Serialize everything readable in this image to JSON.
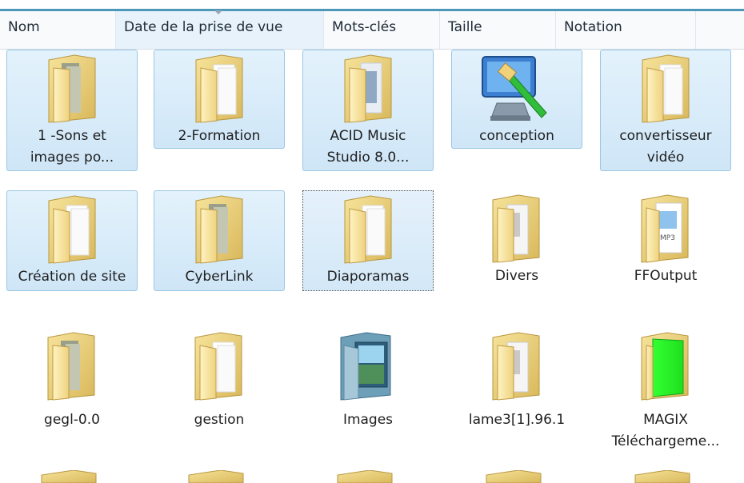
{
  "columns": [
    "Nom",
    "Date de la prise de vue",
    "Mots-clés",
    "Taille",
    "Notation"
  ],
  "items": [
    {
      "l1": "1 -Sons et",
      "l2": "images po...",
      "icon": "folder-files-icon"
    },
    {
      "l1": "2-Formation",
      "l2": "",
      "icon": "folder-icon"
    },
    {
      "l1": "ACID Music",
      "l2": "Studio 8.0...",
      "icon": "folder-files-icon"
    },
    {
      "l1": "conception",
      "l2": "",
      "icon": "computer-brush-icon"
    },
    {
      "l1": "convertisseur",
      "l2": "vidéo",
      "icon": "folder-icon"
    },
    {
      "l1": "Création de site",
      "l2": "",
      "icon": "folder-icon"
    },
    {
      "l1": "CyberLink",
      "l2": "",
      "icon": "folder-files-icon"
    },
    {
      "l1": "Diaporamas",
      "l2": "",
      "icon": "folder-icon"
    },
    {
      "l1": "Divers",
      "l2": "",
      "icon": "folder-files-icon"
    },
    {
      "l1": "FFOutput",
      "l2": "",
      "icon": "folder-mp3-icon"
    },
    {
      "l1": "gegl-0.0",
      "l2": "",
      "icon": "folder-files-icon"
    },
    {
      "l1": "gestion",
      "l2": "",
      "icon": "folder-icon"
    },
    {
      "l1": "Images",
      "l2": "",
      "icon": "folder-images-icon"
    },
    {
      "l1": "lame3[1].96.1",
      "l2": "",
      "icon": "folder-files-icon"
    },
    {
      "l1": "MAGIX",
      "l2": "Téléchargeme...",
      "icon": "folder-green-icon"
    }
  ]
}
